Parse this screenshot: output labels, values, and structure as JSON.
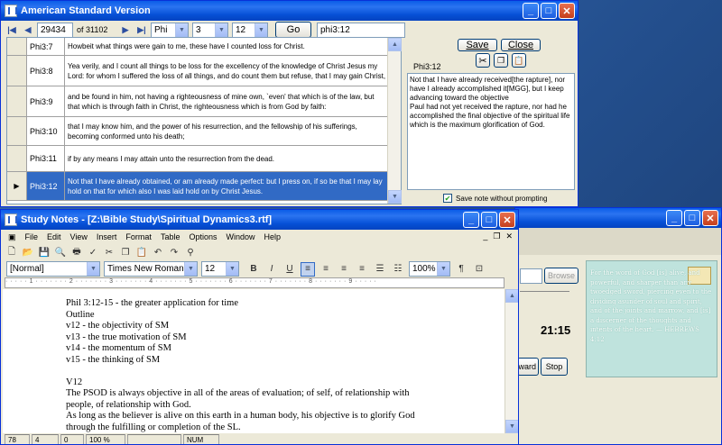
{
  "bible_window": {
    "title": "American Standard Version",
    "nav": {
      "record": "29434",
      "of_label": "of 31102",
      "book": "Phi",
      "chapter": "3",
      "verse": "12",
      "go_label": "Go",
      "ref_field": "phi3:12"
    },
    "verses": [
      {
        "ref": "Phi3:7",
        "text": "Howbeit what things were gain to me, these have I counted loss for Christ."
      },
      {
        "ref": "Phi3:8",
        "text": "Yea verily, and I count all things to be loss for the excellency of the knowledge of Christ Jesus my Lord: for whom I suffered the loss of all things, and do count them but refuse, that I may gain Christ,"
      },
      {
        "ref": "Phi3:9",
        "text": "and be found in him, not having a righteousness of mine own, `even' that which is of the law, but that which is through faith in Christ, the righteousness which is from God by faith:"
      },
      {
        "ref": "Phi3:10",
        "text": "that I may know him, and the power of his resurrection, and the fellowship of his sufferings, becoming conformed unto his death;"
      },
      {
        "ref": "Phi3:11",
        "text": "if by any means I may attain unto the resurrection from the dead."
      },
      {
        "ref": "Phi3:12",
        "text": "Not that I have already obtained, or am already made perfect: but I press on, if so be that I may lay hold on that for which also I was laid hold on by Christ Jesus."
      }
    ],
    "note_panel": {
      "save_label": "Save",
      "close_label": "Close",
      "ref": "Phi3:12",
      "note": "Not that I have already received[the rapture], nor have I already accomplished it[MGG], but I keep advancing toward the objective\nPaul had not yet received the rapture, nor had he accomplished the final objective of the spiritual life which is the maximum glorification of God.",
      "save_without_prompt": "Save note without prompting"
    }
  },
  "notes_window": {
    "title": "Study Notes - [Z:\\Bible Study\\Spiritual Dynamics3.rtf]",
    "menu": [
      "File",
      "Edit",
      "View",
      "Insert",
      "Format",
      "Table",
      "Options",
      "Window",
      "Help"
    ],
    "format": {
      "style": "[Normal]",
      "font": "Times New Roman",
      "size": "12",
      "zoom": "100%"
    },
    "lines": [
      "Phil 3:12-15 - the greater application for time",
      "Outline",
      "v12 - the objectivity of SM",
      "v13 - the true motivation of SM",
      "v14 - the momentum of SM",
      "v15 - the thinking of SM",
      "",
      "V12",
      "The PSOD is always objective in all of the areas of evaluation; of self, of relationship with",
      "people, of relationship with God.",
      "As long as the believer is alive on this earth in a human body, his objective is to glorify God",
      "through the fulfilling or completion of the SL."
    ],
    "status": [
      "78",
      "4",
      "0",
      "100 %",
      "",
      "NUM"
    ]
  },
  "back_window": {
    "browse_label": "Browse",
    "time": "21:15",
    "forward_label": "ward",
    "stop_label": "Stop",
    "verse_card": "For the word of God [is] alive, and powerful, and sharper than any twoedged sword, piercing even to the dividing asunder of soul and spirit, and of the joints and marrow, and [is] a discerner of the thoughts and intents of the heart. — HEBREWS 4:12"
  },
  "colors": {
    "accent": "#316ac5",
    "titlebar": "#0a5de8",
    "card": "#bfe3dd"
  }
}
